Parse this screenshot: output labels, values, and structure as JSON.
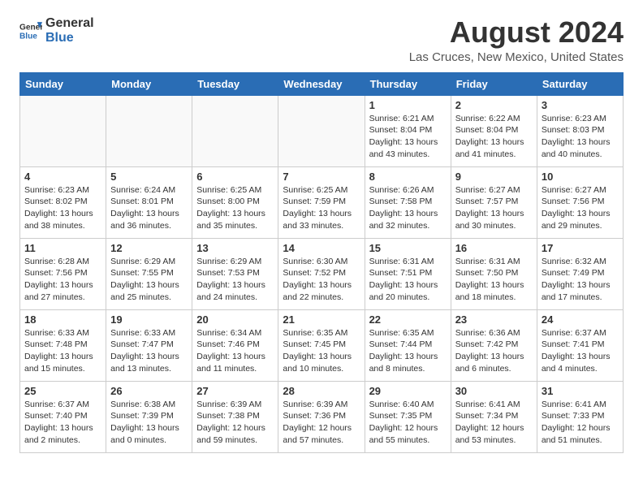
{
  "header": {
    "logo_general": "General",
    "logo_blue": "Blue",
    "month_year": "August 2024",
    "location": "Las Cruces, New Mexico, United States"
  },
  "days_of_week": [
    "Sunday",
    "Monday",
    "Tuesday",
    "Wednesday",
    "Thursday",
    "Friday",
    "Saturday"
  ],
  "weeks": [
    [
      {
        "day": "",
        "info": ""
      },
      {
        "day": "",
        "info": ""
      },
      {
        "day": "",
        "info": ""
      },
      {
        "day": "",
        "info": ""
      },
      {
        "day": "1",
        "info": "Sunrise: 6:21 AM\nSunset: 8:04 PM\nDaylight: 13 hours\nand 43 minutes."
      },
      {
        "day": "2",
        "info": "Sunrise: 6:22 AM\nSunset: 8:04 PM\nDaylight: 13 hours\nand 41 minutes."
      },
      {
        "day": "3",
        "info": "Sunrise: 6:23 AM\nSunset: 8:03 PM\nDaylight: 13 hours\nand 40 minutes."
      }
    ],
    [
      {
        "day": "4",
        "info": "Sunrise: 6:23 AM\nSunset: 8:02 PM\nDaylight: 13 hours\nand 38 minutes."
      },
      {
        "day": "5",
        "info": "Sunrise: 6:24 AM\nSunset: 8:01 PM\nDaylight: 13 hours\nand 36 minutes."
      },
      {
        "day": "6",
        "info": "Sunrise: 6:25 AM\nSunset: 8:00 PM\nDaylight: 13 hours\nand 35 minutes."
      },
      {
        "day": "7",
        "info": "Sunrise: 6:25 AM\nSunset: 7:59 PM\nDaylight: 13 hours\nand 33 minutes."
      },
      {
        "day": "8",
        "info": "Sunrise: 6:26 AM\nSunset: 7:58 PM\nDaylight: 13 hours\nand 32 minutes."
      },
      {
        "day": "9",
        "info": "Sunrise: 6:27 AM\nSunset: 7:57 PM\nDaylight: 13 hours\nand 30 minutes."
      },
      {
        "day": "10",
        "info": "Sunrise: 6:27 AM\nSunset: 7:56 PM\nDaylight: 13 hours\nand 29 minutes."
      }
    ],
    [
      {
        "day": "11",
        "info": "Sunrise: 6:28 AM\nSunset: 7:56 PM\nDaylight: 13 hours\nand 27 minutes."
      },
      {
        "day": "12",
        "info": "Sunrise: 6:29 AM\nSunset: 7:55 PM\nDaylight: 13 hours\nand 25 minutes."
      },
      {
        "day": "13",
        "info": "Sunrise: 6:29 AM\nSunset: 7:53 PM\nDaylight: 13 hours\nand 24 minutes."
      },
      {
        "day": "14",
        "info": "Sunrise: 6:30 AM\nSunset: 7:52 PM\nDaylight: 13 hours\nand 22 minutes."
      },
      {
        "day": "15",
        "info": "Sunrise: 6:31 AM\nSunset: 7:51 PM\nDaylight: 13 hours\nand 20 minutes."
      },
      {
        "day": "16",
        "info": "Sunrise: 6:31 AM\nSunset: 7:50 PM\nDaylight: 13 hours\nand 18 minutes."
      },
      {
        "day": "17",
        "info": "Sunrise: 6:32 AM\nSunset: 7:49 PM\nDaylight: 13 hours\nand 17 minutes."
      }
    ],
    [
      {
        "day": "18",
        "info": "Sunrise: 6:33 AM\nSunset: 7:48 PM\nDaylight: 13 hours\nand 15 minutes."
      },
      {
        "day": "19",
        "info": "Sunrise: 6:33 AM\nSunset: 7:47 PM\nDaylight: 13 hours\nand 13 minutes."
      },
      {
        "day": "20",
        "info": "Sunrise: 6:34 AM\nSunset: 7:46 PM\nDaylight: 13 hours\nand 11 minutes."
      },
      {
        "day": "21",
        "info": "Sunrise: 6:35 AM\nSunset: 7:45 PM\nDaylight: 13 hours\nand 10 minutes."
      },
      {
        "day": "22",
        "info": "Sunrise: 6:35 AM\nSunset: 7:44 PM\nDaylight: 13 hours\nand 8 minutes."
      },
      {
        "day": "23",
        "info": "Sunrise: 6:36 AM\nSunset: 7:42 PM\nDaylight: 13 hours\nand 6 minutes."
      },
      {
        "day": "24",
        "info": "Sunrise: 6:37 AM\nSunset: 7:41 PM\nDaylight: 13 hours\nand 4 minutes."
      }
    ],
    [
      {
        "day": "25",
        "info": "Sunrise: 6:37 AM\nSunset: 7:40 PM\nDaylight: 13 hours\nand 2 minutes."
      },
      {
        "day": "26",
        "info": "Sunrise: 6:38 AM\nSunset: 7:39 PM\nDaylight: 13 hours\nand 0 minutes."
      },
      {
        "day": "27",
        "info": "Sunrise: 6:39 AM\nSunset: 7:38 PM\nDaylight: 12 hours\nand 59 minutes."
      },
      {
        "day": "28",
        "info": "Sunrise: 6:39 AM\nSunset: 7:36 PM\nDaylight: 12 hours\nand 57 minutes."
      },
      {
        "day": "29",
        "info": "Sunrise: 6:40 AM\nSunset: 7:35 PM\nDaylight: 12 hours\nand 55 minutes."
      },
      {
        "day": "30",
        "info": "Sunrise: 6:41 AM\nSunset: 7:34 PM\nDaylight: 12 hours\nand 53 minutes."
      },
      {
        "day": "31",
        "info": "Sunrise: 6:41 AM\nSunset: 7:33 PM\nDaylight: 12 hours\nand 51 minutes."
      }
    ]
  ]
}
